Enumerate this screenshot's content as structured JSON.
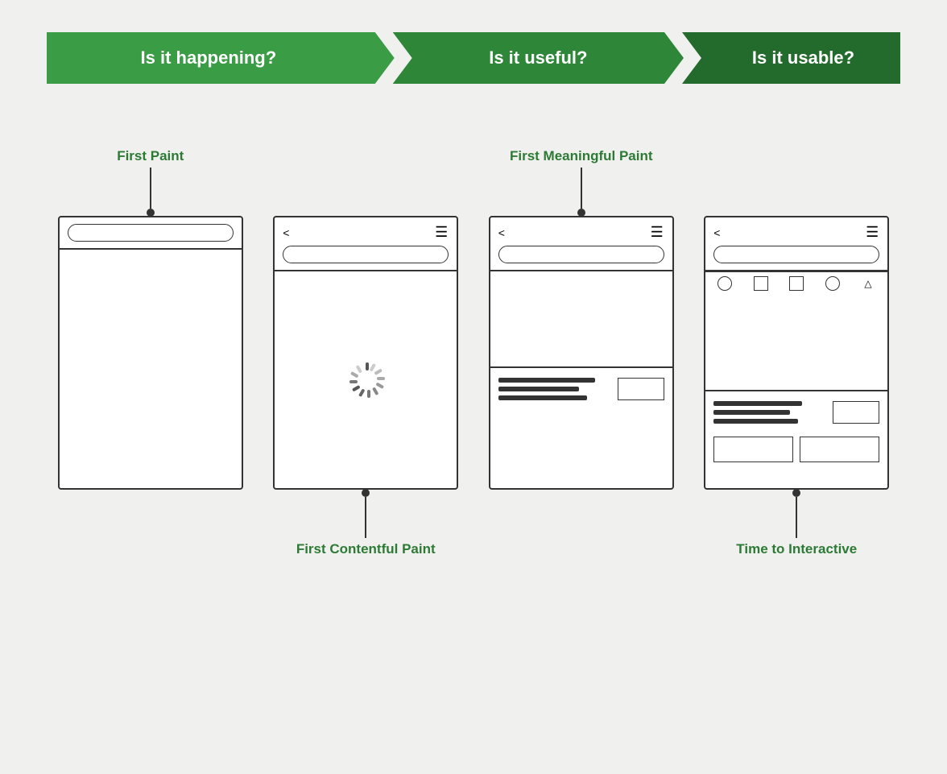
{
  "banner": {
    "segments": [
      {
        "id": "seg1",
        "label": "Is it happening?"
      },
      {
        "id": "seg2",
        "label": "Is it useful?"
      },
      {
        "id": "seg3",
        "label": "Is it usable?"
      }
    ]
  },
  "columns": [
    {
      "id": "first-paint",
      "label_above": "First Paint",
      "label_below": null,
      "connector": "top"
    },
    {
      "id": "first-contentful-paint",
      "label_above": null,
      "label_below": "First Contentful Paint",
      "connector": "bottom"
    },
    {
      "id": "first-meaningful-paint",
      "label_above": "First Meaningful Paint",
      "label_below": null,
      "connector": "top"
    },
    {
      "id": "time-to-interactive",
      "label_above": null,
      "label_below": "Time to Interactive",
      "connector": "bottom"
    }
  ],
  "colors": {
    "green_light": "#3a9c45",
    "green_mid": "#2e8738",
    "green_dark": "#236b2c",
    "label_green": "#2d7a35",
    "border": "#333"
  }
}
